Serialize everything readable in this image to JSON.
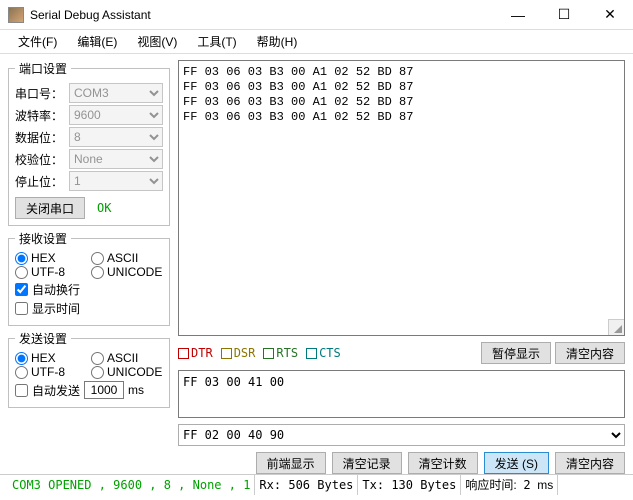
{
  "window": {
    "title": "Serial Debug Assistant"
  },
  "menu": {
    "file": "文件(F)",
    "edit": "编辑(E)",
    "view": "视图(V)",
    "tools": "工具(T)",
    "help": "帮助(H)"
  },
  "port_settings": {
    "legend": "端口设置",
    "port_label": "串口号：",
    "port_value": "COM3",
    "baud_label": "波特率：",
    "baud_value": "9600",
    "data_label": "数据位：",
    "data_value": "8",
    "parity_label": "校验位：",
    "parity_value": "None",
    "stop_label": "停止位：",
    "stop_value": "1",
    "close_btn": "关闭串口",
    "status": "OK"
  },
  "recv_settings": {
    "legend": "接收设置",
    "hex": "HEX",
    "ascii": "ASCII",
    "utf8": "UTF-8",
    "unicode": "UNICODE",
    "autowrap": "自动换行",
    "showtime": "显示时间"
  },
  "send_settings": {
    "legend": "发送设置",
    "hex": "HEX",
    "ascii": "ASCII",
    "utf8": "UTF-8",
    "unicode": "UNICODE",
    "autosend": "自动发送",
    "interval": "1000",
    "unit": "ms"
  },
  "received_text": "FF 03 06 03 B3 00 A1 02 52 BD 87 \nFF 03 06 03 B3 00 A1 02 52 BD 87 \nFF 03 06 03 B3 00 A1 02 52 BD 87 \nFF 03 06 03 B3 00 A1 02 52 BD 87 ",
  "signals": {
    "dtr": "DTR",
    "dsr": "DSR",
    "rts": "RTS",
    "cts": "CTS"
  },
  "btns": {
    "pause": "暂停显示",
    "clear_recv": "清空内容",
    "front": "前端显示",
    "clear_log": "清空记录",
    "clear_count": "清空计数",
    "send": "发送 (S)",
    "clear_send": "清空内容"
  },
  "send_text": "FF 03 00 41 00",
  "history_value": "FF 02 00 40 90",
  "status": {
    "conn": "COM3 OPENED , 9600 , 8 , None , 1",
    "rx_label": "Rx:",
    "rx_value": "506",
    "tx_label": "Tx:",
    "tx_value": "130",
    "bytes": "Bytes",
    "resp_label": "响应时间:",
    "resp_value": "2",
    "resp_unit": "ms"
  }
}
